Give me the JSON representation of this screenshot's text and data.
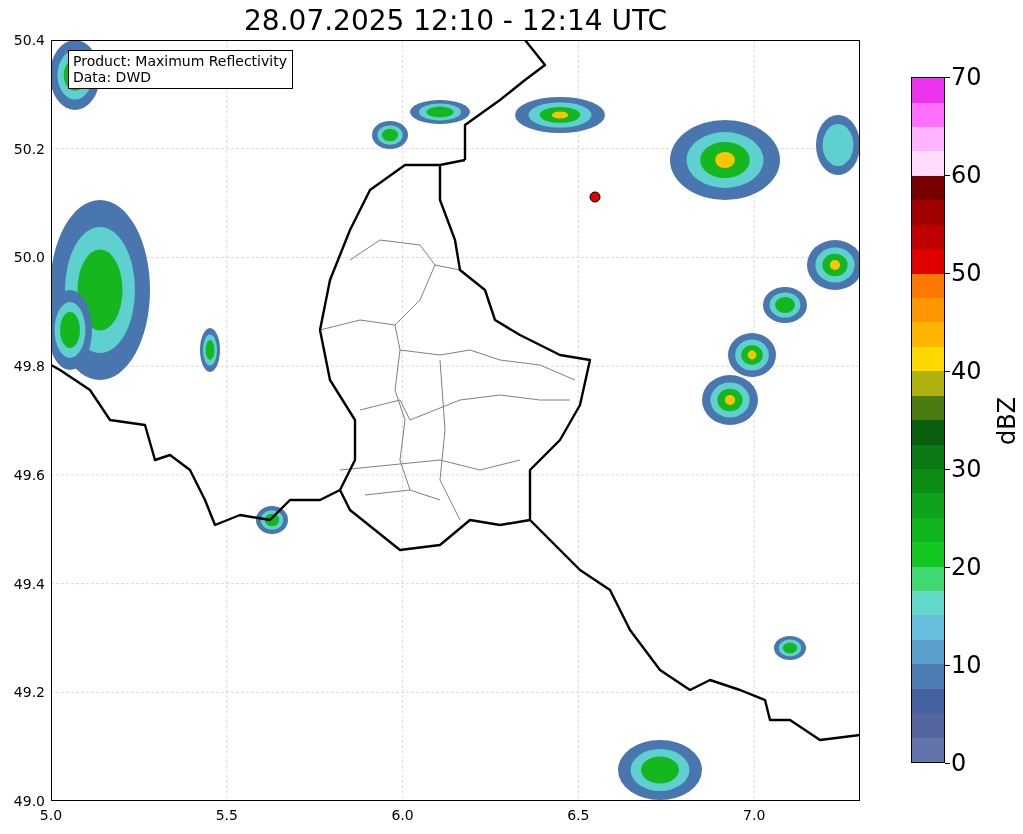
{
  "title": "28.07.2025 12:10 - 12:14 UTC",
  "map": {
    "info_box": [
      "Product: Maximum Reflectivity",
      "Data: DWD"
    ],
    "y_ticks": [
      "50.4",
      "50.2",
      "50.0",
      "49.8",
      "49.6",
      "49.4",
      "49.2",
      "49.0"
    ],
    "x_ticks": [
      "5.0",
      "5.5",
      "6.0",
      "6.5",
      "7.0"
    ]
  },
  "colorbar": {
    "label": "dBZ",
    "ticks": [
      "70",
      "60",
      "50",
      "40",
      "30",
      "20",
      "10",
      "0"
    ],
    "bands": [
      {
        "color": "#6173a8"
      },
      {
        "color": "#5466a0"
      },
      {
        "color": "#4760a0"
      },
      {
        "color": "#4b7cb3"
      },
      {
        "color": "#5aa0cc"
      },
      {
        "color": "#65c0e0"
      },
      {
        "color": "#62d8c8"
      },
      {
        "color": "#3fd96f"
      },
      {
        "color": "#12c81e"
      },
      {
        "color": "#0fb51d"
      },
      {
        "color": "#0ea31a"
      },
      {
        "color": "#0d8c14"
      },
      {
        "color": "#0b7a14"
      },
      {
        "color": "#0a5e10"
      },
      {
        "color": "#4a7c12"
      },
      {
        "color": "#b0b00e"
      },
      {
        "color": "#ffd800"
      },
      {
        "color": "#ffb400"
      },
      {
        "color": "#ff9600"
      },
      {
        "color": "#ff7800"
      },
      {
        "color": "#e00000"
      },
      {
        "color": "#c00000"
      },
      {
        "color": "#a00000"
      },
      {
        "color": "#780000"
      },
      {
        "color": "#ffdcff"
      },
      {
        "color": "#ffb4ff"
      },
      {
        "color": "#ff6eff"
      },
      {
        "color": "#ee33ee"
      }
    ]
  }
}
